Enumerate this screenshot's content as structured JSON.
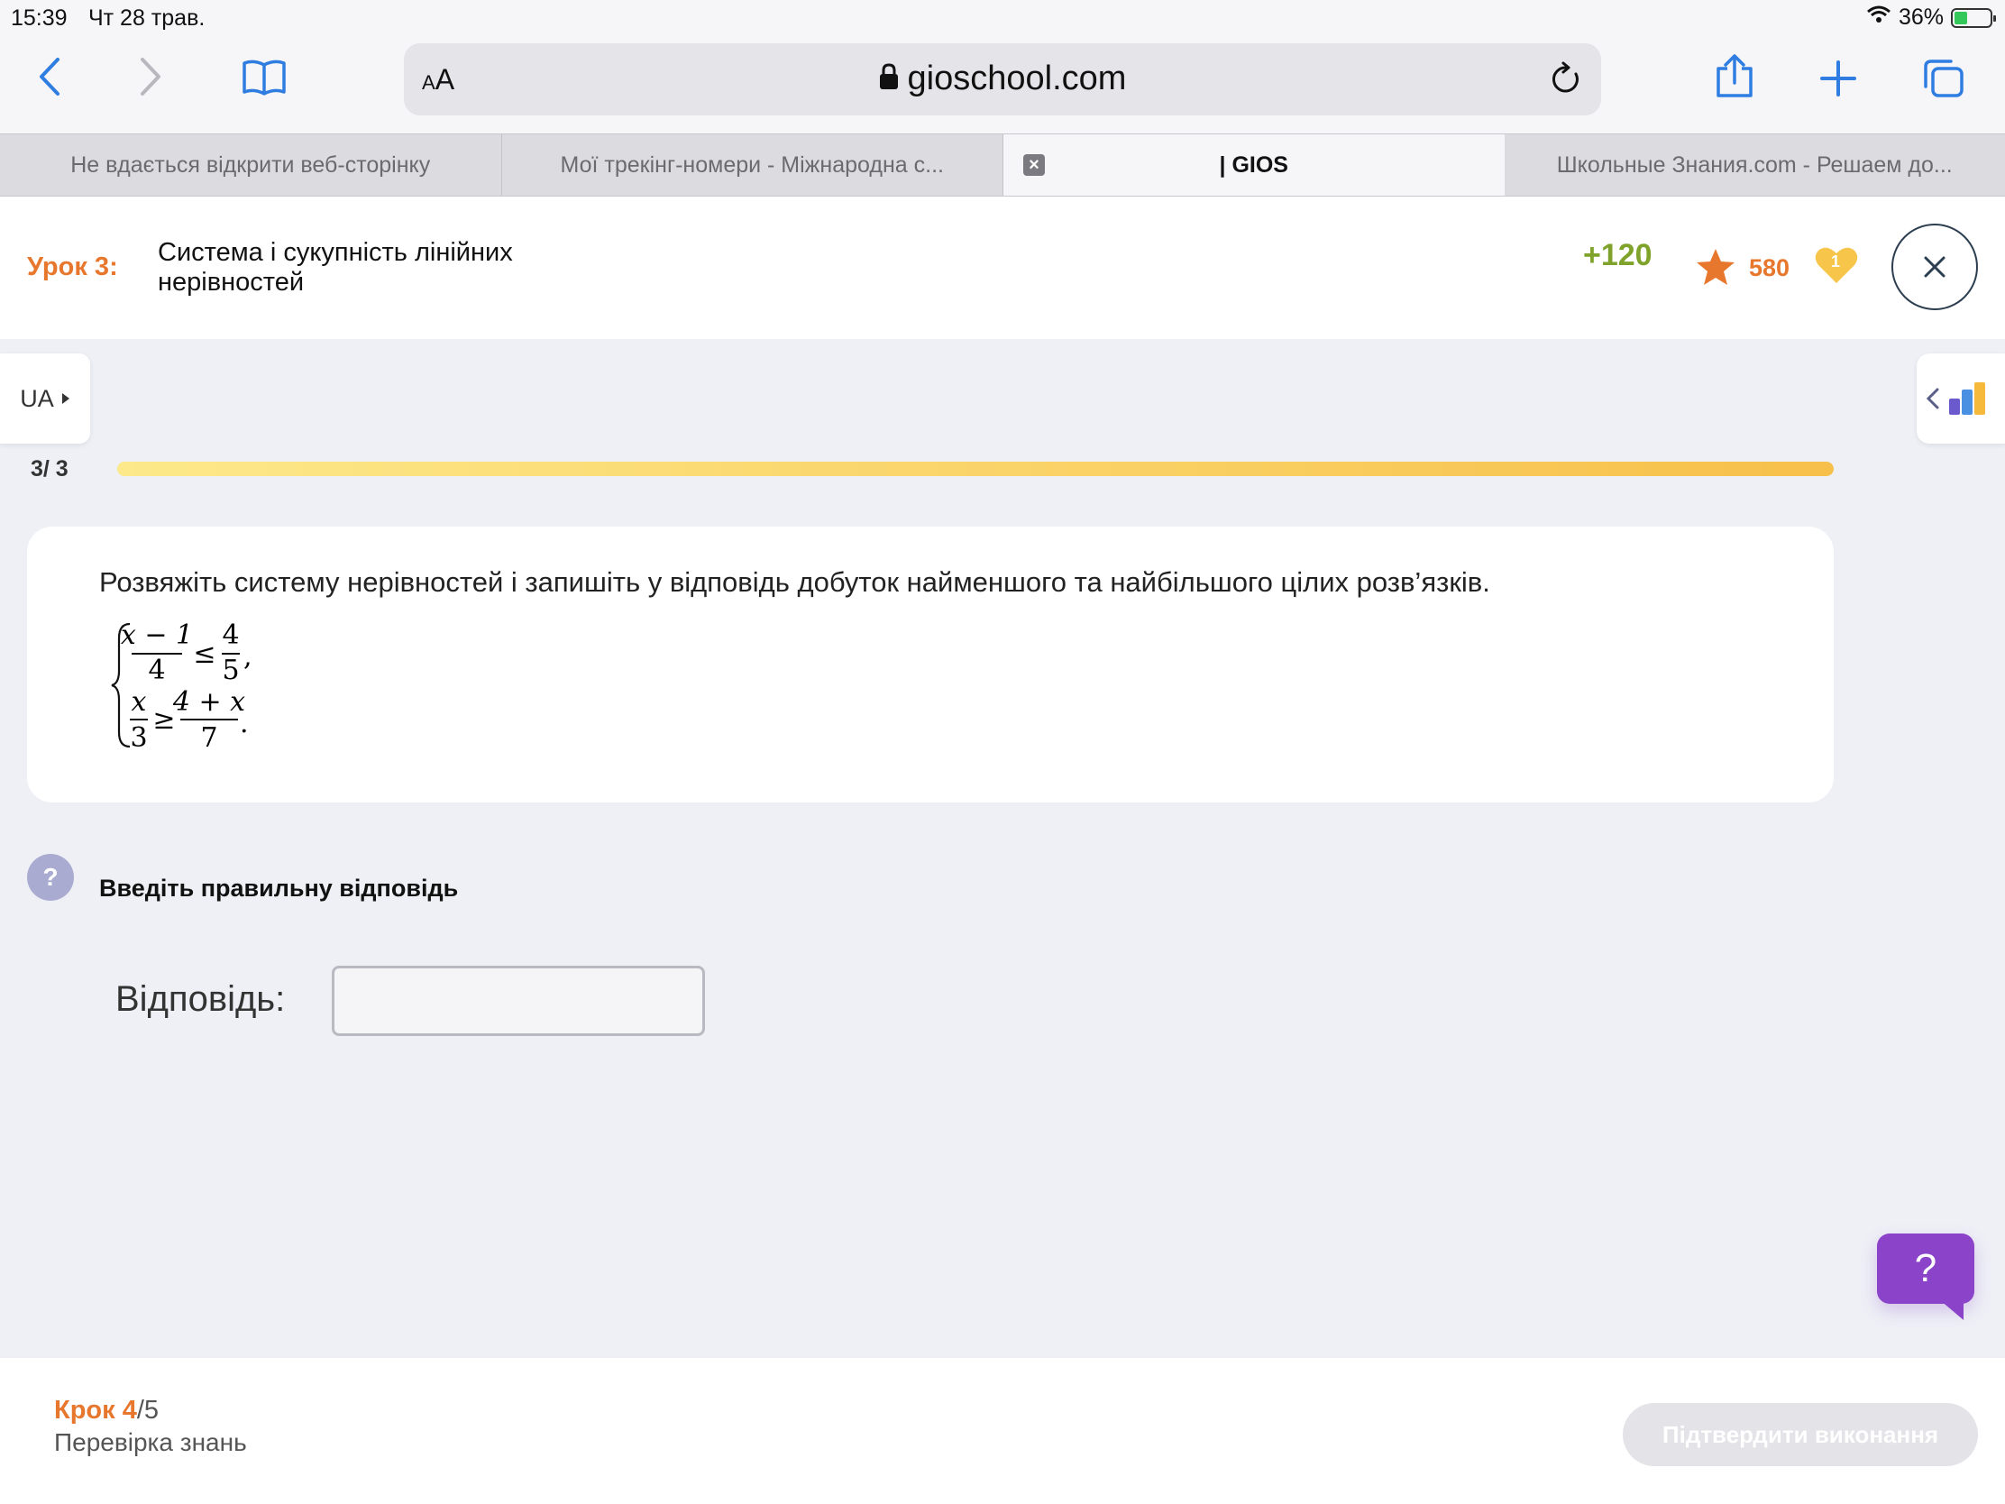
{
  "status_bar": {
    "time": "15:39",
    "date": "Чт 28 трав.",
    "battery": "36%"
  },
  "browser": {
    "aa_label": "AA",
    "domain": "gioschool.com",
    "tabs": [
      {
        "title": "Не вдається відкрити веб-сторінку"
      },
      {
        "title": "Мої трекінг-номери - Міжнародна с..."
      },
      {
        "title": "| GIOS"
      },
      {
        "title": "Школьные Знания.com - Решаем до..."
      }
    ]
  },
  "lesson": {
    "label": "Урок 3:",
    "title": "Система і сукупність лінійних нерівностей",
    "points": "+120",
    "stars": "580",
    "hearts": "1"
  },
  "language": "UA",
  "progress": {
    "text": "3/ 3",
    "fraction": 1.0
  },
  "question": {
    "text": "Розвяжіть систему нерівностей і запишіть у відповідь добуток найменшого та найбільшого цілих  розв’язків.",
    "system": {
      "row1": {
        "num1": "x − 1",
        "den1": "4",
        "op": "≤",
        "num2": "4",
        "den2": "5",
        "end": ","
      },
      "row2": {
        "num1": "x",
        "den1": "3",
        "op": "≥",
        "num2": "4 + x",
        "den2": "7",
        "end": "."
      }
    }
  },
  "instruction": "Введіть правильну відповідь",
  "answer": {
    "label": "Відповідь:",
    "value": "",
    "placeholder": ""
  },
  "chat_button": "?",
  "footer": {
    "step_label": "Крок",
    "step_current": "4",
    "step_total": "/5",
    "step_name": "Перевірка знань",
    "confirm": "Підтвердити виконання"
  },
  "colors": {
    "accent": "#e8772e",
    "points": "#7fa32a",
    "progress": "#f7c04a",
    "chat": "#8a43c9",
    "link_blue": "#2f7de1"
  }
}
